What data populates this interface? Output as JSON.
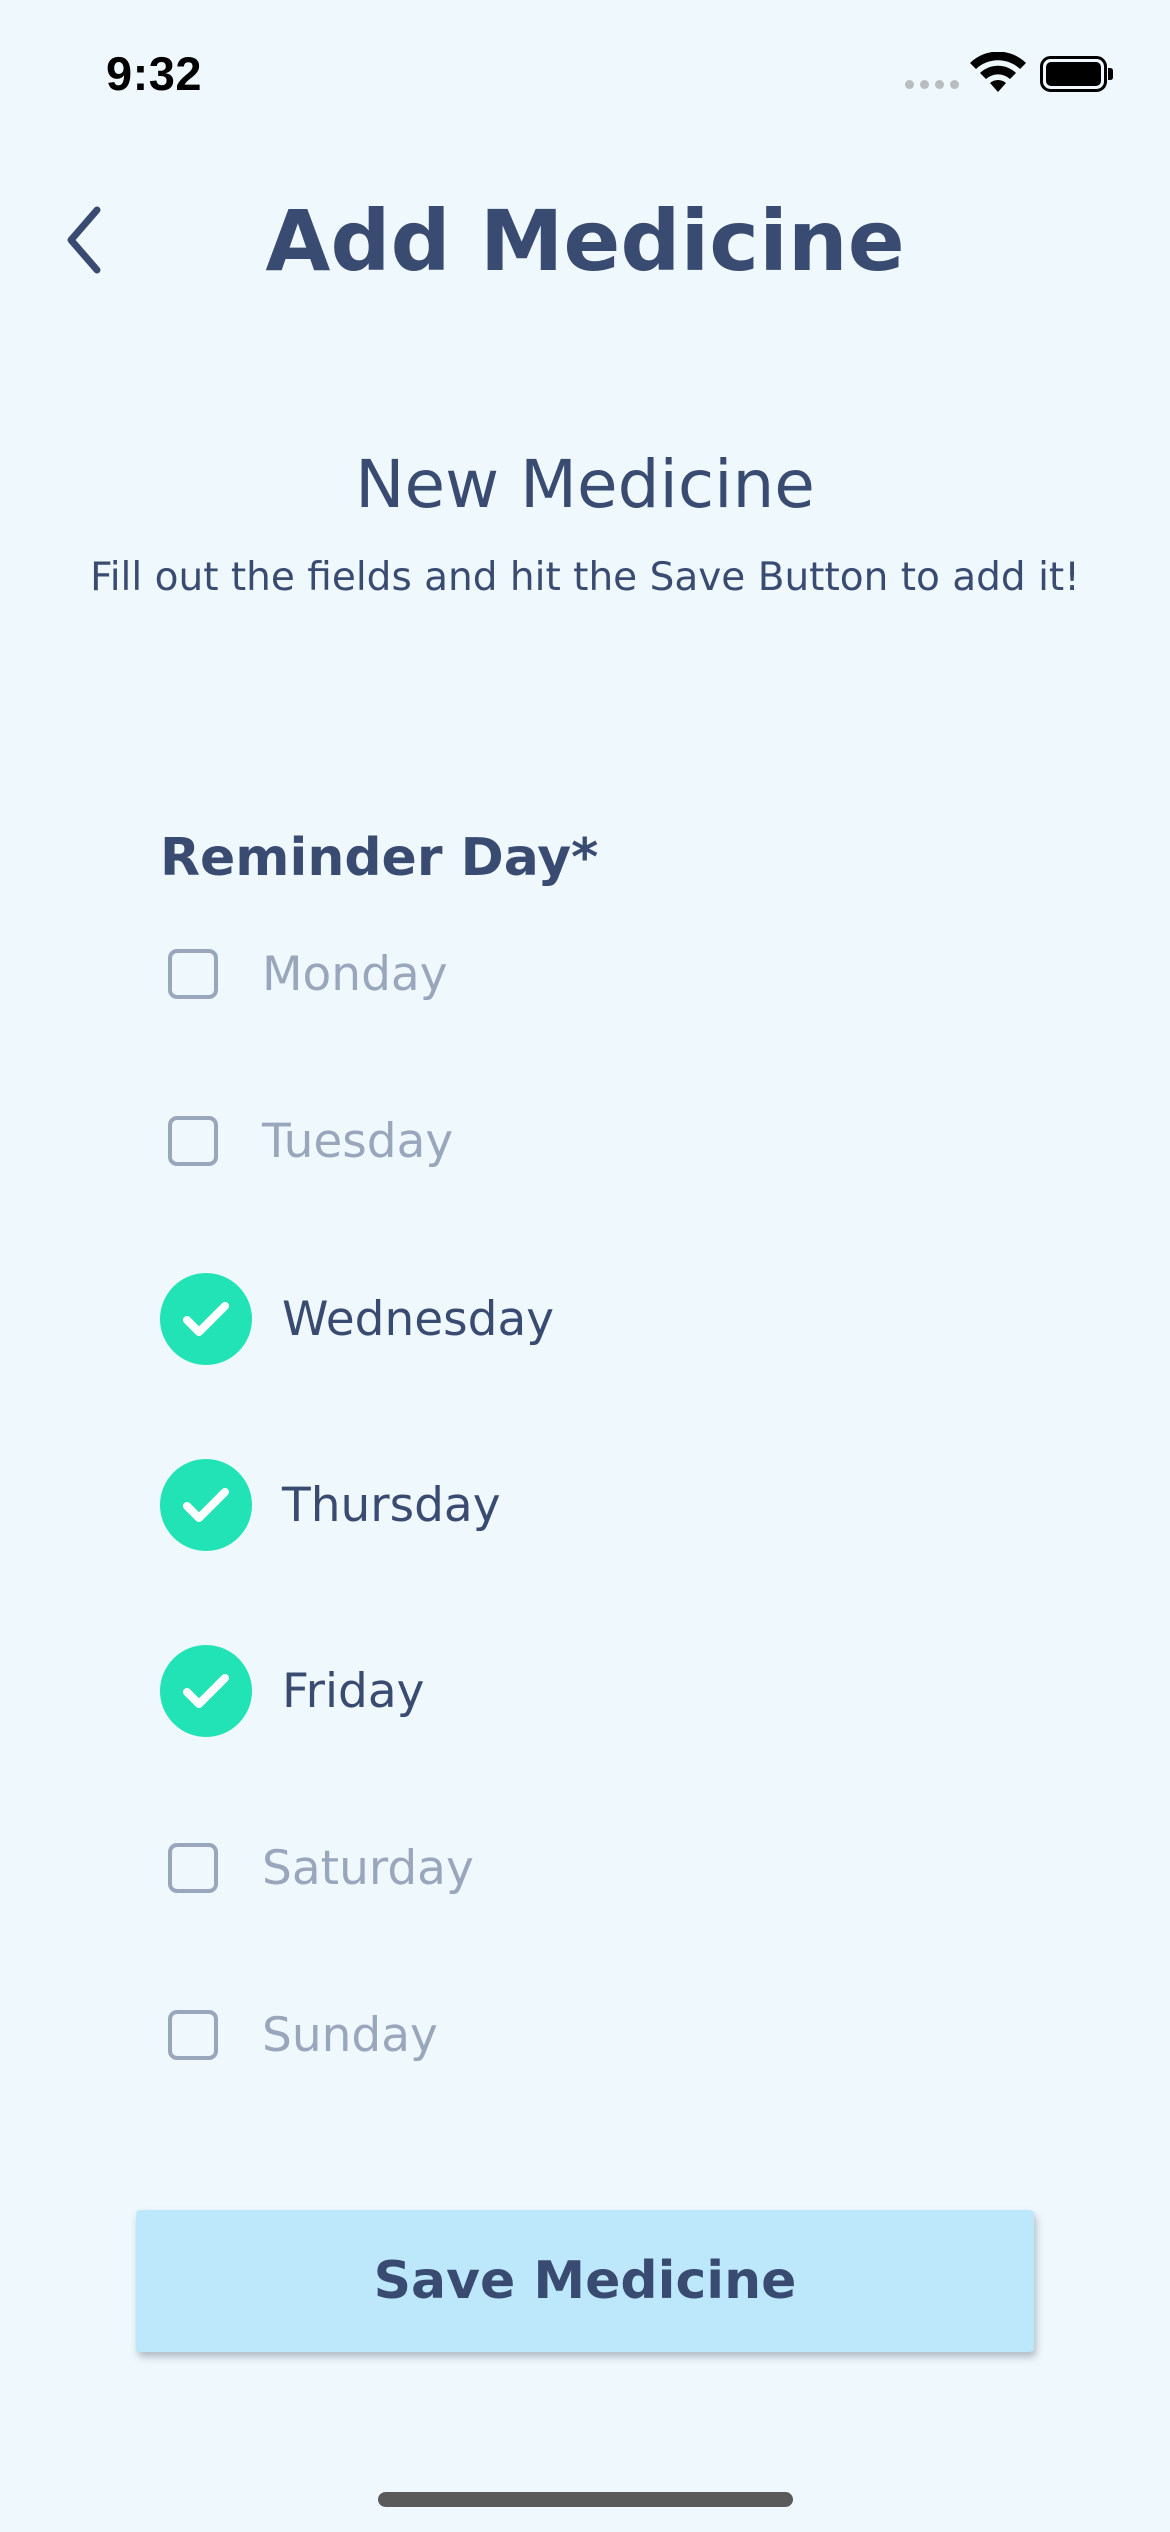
{
  "status_bar": {
    "time": "9:32",
    "icons": [
      "signal-dots-icon",
      "wifi-icon",
      "battery-icon"
    ]
  },
  "header": {
    "back_icon": "chevron-left-icon",
    "title": "Add Medicine"
  },
  "form": {
    "title": "New Medicine",
    "subtitle": "Fill out the fields and hit the Save Button to add it!",
    "reminder_label": "Reminder Day*",
    "days": [
      {
        "label": "Monday",
        "checked": false
      },
      {
        "label": "Tuesday",
        "checked": false
      },
      {
        "label": "Wednesday",
        "checked": true
      },
      {
        "label": "Thursday",
        "checked": true
      },
      {
        "label": "Friday",
        "checked": true
      },
      {
        "label": "Saturday",
        "checked": false
      },
      {
        "label": "Sunday",
        "checked": false
      }
    ],
    "save_label": "Save Medicine"
  },
  "colors": {
    "background": "#eff9fd",
    "primary_text": "#3a4b72",
    "muted_text": "#9aa6bb",
    "check_accent": "#22e3b5",
    "button_bg": "#bde8fb"
  }
}
